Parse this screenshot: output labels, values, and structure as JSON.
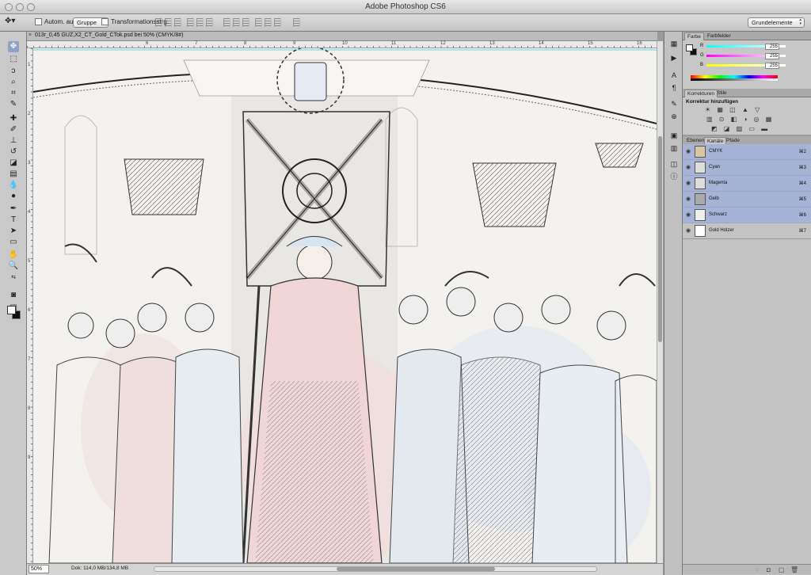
{
  "window": {
    "title": "Adobe Photoshop CS6"
  },
  "options_bar": {
    "auto_select_label": "Autom. ausw.:",
    "auto_select_value": "Gruppe",
    "transform_controls_label": "Transformationsstrg.",
    "workspace_value": "Grundelemente"
  },
  "document": {
    "tab_title": "013r_0,45 GUZ,X2_CT_Gold_CTok.psd bei 50% (CMYK/8#)",
    "zoom": "50%",
    "doc_size": "Dok: 114,0 MB/134,8 MB",
    "ruler_h": [
      "6",
      "7",
      "8",
      "9",
      "10",
      "11",
      "12",
      "13",
      "14",
      "15",
      "16"
    ],
    "ruler_v": [
      "1",
      "2",
      "3",
      "4",
      "5",
      "6",
      "7",
      "8",
      "9"
    ]
  },
  "color_panel": {
    "tabs": [
      "Farbe",
      "Farbfelder"
    ],
    "sliders": [
      {
        "label": "R",
        "value": "255"
      },
      {
        "label": "G",
        "value": "255"
      },
      {
        "label": "B",
        "value": "255"
      }
    ]
  },
  "adjustments_panel": {
    "tabs": [
      "Korrekturen",
      "Stile"
    ],
    "heading": "Korrektur hinzufügen",
    "row1": "☀ ▦ ◫ ▲ ▽",
    "row2": "▥ ⊙ ◧ ◑ ◎ ▦",
    "row3": "◩ ◪ ▨ ▭ ▬"
  },
  "channels_panel": {
    "tabs": [
      "Ebenen",
      "Kanäle",
      "Pfade"
    ],
    "channels": [
      {
        "name": "CMYK",
        "shortcut": "⌘2",
        "selected": true
      },
      {
        "name": "Cyan",
        "shortcut": "⌘3",
        "selected": true
      },
      {
        "name": "Magenta",
        "shortcut": "⌘4",
        "selected": true
      },
      {
        "name": "Gelb",
        "shortcut": "⌘5",
        "selected": true
      },
      {
        "name": "Schwarz",
        "shortcut": "⌘6",
        "selected": true
      },
      {
        "name": "Gold Holzer",
        "shortcut": "⌘7",
        "selected": false
      }
    ]
  },
  "colors": {
    "selection": "#a6b3d6",
    "panel": "#c7c7c7",
    "canvas": "#f3f2ef"
  }
}
